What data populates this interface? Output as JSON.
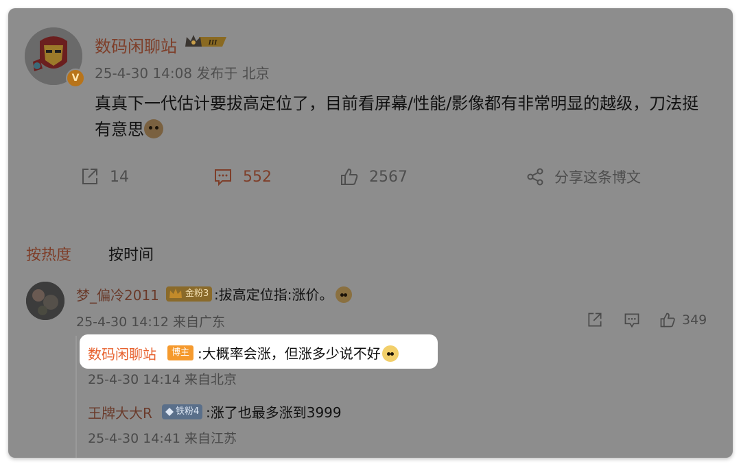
{
  "post": {
    "author": "数码闲聊站",
    "meta": "25-4-30 14:08 发布于 北京",
    "text": "真真下一代估计要拔高定位了，目前看屏幕/性能/影像都有非常明显的越级，刀法挺有意思",
    "crown_level": "III",
    "verified_badge": "V",
    "actions": {
      "repost_count": "14",
      "comment_count": "552",
      "like_count": "2567",
      "share_label": "分享这条博文"
    }
  },
  "sort_tabs": {
    "hot": "按热度",
    "time": "按时间"
  },
  "comments": [
    {
      "user": "梦_偏冷2011",
      "badge": "金粉3",
      "text": ":拔高定位指:涨价。",
      "meta": "25-4-30 14:12 来自广东",
      "like_count": "349",
      "replies": [
        {
          "user": "数码闲聊站",
          "badge": "博主",
          "text": ":大概率会涨，但涨多少说不好",
          "meta": "25-4-30 14:14 来自北京"
        },
        {
          "user": "王牌大大R",
          "badge": "铁粉4",
          "text": ":涨了也最多涨到3999",
          "meta": "25-4-30 14:41 来自江苏"
        }
      ]
    }
  ],
  "colors": {
    "overlay": "#8d8d8d",
    "author_name": "#7e3e29",
    "reply_author_highlight": "#e7612e",
    "host_badge": "#f59a2e",
    "gold_fan_badge": "#8a6a2a",
    "iron_fan_badge": "#5a6f8a"
  },
  "icons": [
    "repost-icon",
    "comment-icon",
    "like-icon",
    "share-icon",
    "crown-icon",
    "shield-icon"
  ]
}
